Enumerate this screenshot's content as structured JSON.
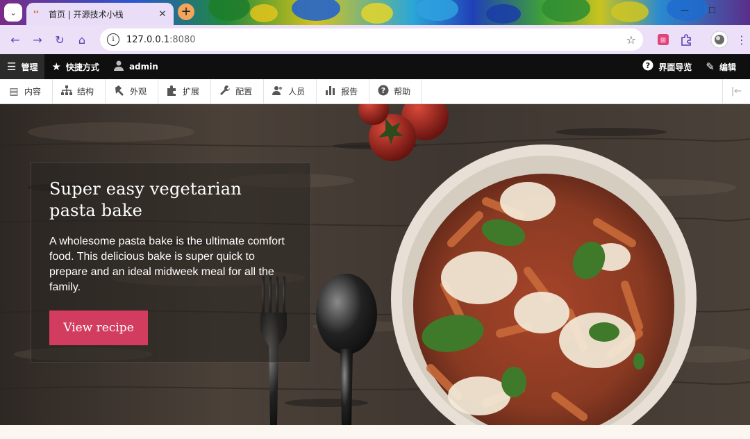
{
  "browser": {
    "tab_title": "首页 | 开源技术小栈",
    "url_host": "127.0.0.1",
    "url_port": ":8080",
    "new_tab_symbol": "+",
    "close_symbol": "✕",
    "icons": [
      "tab-search-icon",
      "favicon-icon",
      "close-icon",
      "new-tab-icon",
      "back-icon",
      "forward-icon",
      "reload-icon",
      "home-icon",
      "site-info-icon",
      "bookmark-star-icon",
      "extension-icon",
      "puzzle-icon",
      "profile-avatar-icon",
      "more-menu-icon"
    ]
  },
  "admin_toolbar": {
    "manage": "管理",
    "shortcuts": "快捷方式",
    "user": "admin",
    "tour": "界面导览",
    "edit": "编辑"
  },
  "tray": {
    "items": [
      {
        "label": "内容",
        "icon": "content-icon"
      },
      {
        "label": "结构",
        "icon": "structure-icon"
      },
      {
        "label": "外观",
        "icon": "appearance-icon"
      },
      {
        "label": "扩展",
        "icon": "extend-icon"
      },
      {
        "label": "配置",
        "icon": "config-icon"
      },
      {
        "label": "人员",
        "icon": "people-icon"
      },
      {
        "label": "报告",
        "icon": "reports-icon"
      },
      {
        "label": "帮助",
        "icon": "help-icon"
      }
    ]
  },
  "hero": {
    "title": "Super easy vegetarian pasta bake",
    "description": "A wholesome pasta bake is the ultimate comfort food. This delicious bake is super quick to prepare and an ideal midweek meal for all the family.",
    "button": "View recipe",
    "button_color": "#d23c5e"
  },
  "colors": {
    "admin_bar": "#0f0f0f",
    "tray_bg": "#ffffff",
    "browser_toolbar": "#ece0f8",
    "page_bg": "#fbf6f0"
  }
}
